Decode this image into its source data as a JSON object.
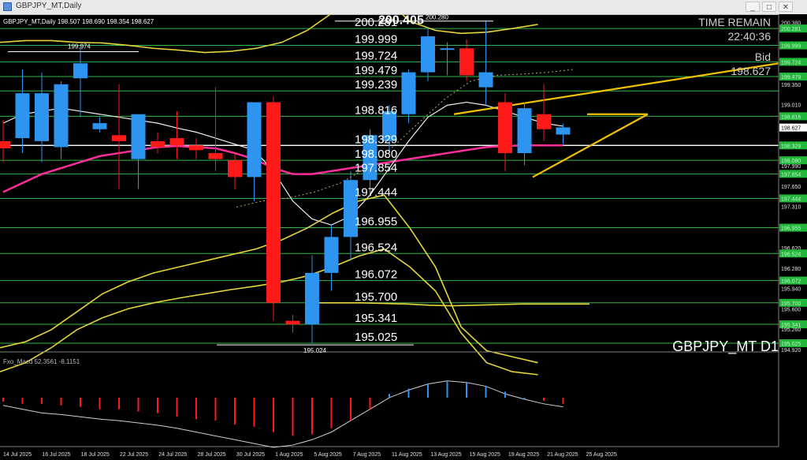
{
  "window": {
    "title": "GBPJPY_MT,Daily",
    "buttons": {
      "minimize": "_",
      "maximize": "□",
      "close": "✕"
    }
  },
  "chart_header": "GBPJPY_MT,Daily  198.507 198.690 198.354 198.627",
  "chart_data": {
    "type": "candlestick",
    "symbol_watermark": "GBPJPY_MT D1",
    "info_panel": {
      "label": "TIME REMAIN",
      "time": "22:40:36",
      "bid_label": "Bid",
      "bid_value": "198.627"
    },
    "ylim": [
      194.92,
      200.52
    ],
    "dates": [
      "14 Jul 2025",
      "16 Jul 2025",
      "18 Jul 2025",
      "22 Jul 2025",
      "24 Jul 2025",
      "28 Jul 2025",
      "30 Jul 2025",
      "1 Aug 2025",
      "5 Aug 2025",
      "7 Aug 2025",
      "11 Aug 2025",
      "13 Aug 2025",
      "15 Aug 2025",
      "19 Aug 2025",
      "21 Aug 2025",
      "25 Aug 2025"
    ],
    "candles": [
      {
        "o": 198.4,
        "h": 198.75,
        "l": 198.05,
        "c": 198.28
      },
      {
        "o": 198.45,
        "h": 199.6,
        "l": 198.2,
        "c": 199.2
      },
      {
        "o": 198.4,
        "h": 199.55,
        "l": 198.05,
        "c": 199.2
      },
      {
        "o": 198.3,
        "h": 199.4,
        "l": 198.1,
        "c": 199.35
      },
      {
        "o": 199.45,
        "h": 199.97,
        "l": 198.8,
        "c": 199.7
      },
      {
        "o": 198.6,
        "h": 198.8,
        "l": 198.55,
        "c": 198.7
      },
      {
        "o": 198.5,
        "h": 199.35,
        "l": 197.6,
        "c": 198.4
      },
      {
        "o": 198.1,
        "h": 198.7,
        "l": 197.6,
        "c": 198.85
      },
      {
        "o": 198.4,
        "h": 198.55,
        "l": 198.2,
        "c": 198.3
      },
      {
        "o": 198.45,
        "h": 198.9,
        "l": 198.1,
        "c": 198.33
      },
      {
        "o": 198.33,
        "h": 198.45,
        "l": 198.1,
        "c": 198.25
      },
      {
        "o": 198.2,
        "h": 199.3,
        "l": 197.9,
        "c": 198.1
      },
      {
        "o": 198.08,
        "h": 198.2,
        "l": 197.6,
        "c": 197.8
      },
      {
        "o": 197.8,
        "h": 198.1,
        "l": 197.4,
        "c": 199.05
      },
      {
        "o": 199.05,
        "h": 199.15,
        "l": 195.4,
        "c": 195.7
      },
      {
        "o": 195.4,
        "h": 195.5,
        "l": 195.2,
        "c": 195.34
      },
      {
        "o": 195.34,
        "h": 196.5,
        "l": 195.02,
        "c": 196.2
      },
      {
        "o": 196.2,
        "h": 197.0,
        "l": 195.9,
        "c": 196.8
      },
      {
        "o": 196.8,
        "h": 197.9,
        "l": 196.4,
        "c": 197.75
      },
      {
        "o": 197.75,
        "h": 198.6,
        "l": 197.5,
        "c": 198.5
      },
      {
        "o": 198.4,
        "h": 199.0,
        "l": 198.2,
        "c": 198.9
      },
      {
        "o": 198.85,
        "h": 199.6,
        "l": 198.7,
        "c": 199.55
      },
      {
        "o": 199.55,
        "h": 200.3,
        "l": 199.4,
        "c": 200.15
      },
      {
        "o": 199.95,
        "h": 200.05,
        "l": 199.5,
        "c": 199.95
      },
      {
        "o": 199.95,
        "h": 200.1,
        "l": 199.4,
        "c": 199.5
      },
      {
        "o": 199.3,
        "h": 200.4,
        "l": 199.0,
        "c": 199.55
      },
      {
        "o": 199.05,
        "h": 199.2,
        "l": 197.9,
        "c": 198.2
      },
      {
        "o": 198.2,
        "h": 199.05,
        "l": 198.0,
        "c": 198.95
      },
      {
        "o": 198.85,
        "h": 199.35,
        "l": 198.4,
        "c": 198.6
      },
      {
        "o": 198.51,
        "h": 198.69,
        "l": 198.35,
        "c": 198.63
      }
    ],
    "levels": [
      "200.281",
      "199.999",
      "199.724",
      "199.479",
      "199.239",
      "198.816",
      "198.329",
      "198.080",
      "197.854",
      "197.444",
      "196.955",
      "196.524",
      "196.072",
      "195.700",
      "195.341",
      "195.025"
    ],
    "marked_labels": {
      "high": "200.405",
      "high_small": "200.280",
      "swing_high": "199.974",
      "low": "195.024"
    },
    "yaxis_ticks": [
      "200.380",
      "200.281",
      "199.999",
      "199.724",
      "199.479",
      "199.350",
      "199.010",
      "198.816",
      "198.627",
      "198.329",
      "198.080",
      "197.990",
      "197.854",
      "197.650",
      "197.444",
      "197.310",
      "196.955",
      "196.620",
      "196.524",
      "196.280",
      "196.072",
      "195.940",
      "195.700",
      "195.600",
      "195.341",
      "195.260",
      "195.025",
      "194.920"
    ],
    "ma_fast": [
      198.7,
      198.85,
      198.9,
      198.95,
      198.9,
      198.85,
      198.8,
      198.75,
      198.7,
      198.62,
      198.55,
      198.45,
      198.35,
      198.25,
      197.9,
      197.4,
      197.1,
      197.0,
      197.15,
      197.5,
      197.95,
      198.4,
      198.8,
      199.0,
      199.05,
      199.0,
      198.9,
      198.8,
      198.7,
      198.65
    ],
    "ma_slow": [
      197.55,
      197.7,
      197.85,
      197.95,
      198.05,
      198.15,
      198.2,
      198.25,
      198.3,
      198.32,
      198.3,
      198.28,
      198.2,
      198.1,
      197.95,
      197.85,
      197.85,
      197.9,
      197.95,
      198.0,
      198.05,
      198.1,
      198.15,
      198.2,
      198.25,
      198.3,
      198.32,
      198.33,
      198.33,
      198.33
    ],
    "band_upper": [
      200.05,
      200.08,
      200.08,
      200.05,
      200.04,
      200.0,
      199.95,
      199.92,
      199.88,
      199.9,
      199.95,
      200.05,
      200.25,
      200.55,
      200.7,
      200.8,
      200.4,
      200.25,
      200.2,
      200.22,
      200.28,
      200.35
    ],
    "band_lower": [
      194.95,
      195.05,
      195.25,
      195.55,
      195.85,
      196.05,
      196.2,
      196.3,
      196.4,
      196.5,
      196.6,
      196.75,
      196.95,
      197.2,
      197.4,
      197.5,
      196.95,
      196.3,
      195.3,
      194.9,
      194.8,
      194.7
    ],
    "band_lower2": [
      194.55,
      194.7,
      194.95,
      195.25,
      195.45,
      195.6,
      195.7,
      195.78,
      195.85,
      195.92,
      195.98,
      196.05,
      196.15,
      196.3,
      196.48,
      196.6,
      196.3,
      195.9,
      195.2,
      194.7,
      194.55,
      194.5
    ],
    "band_yellow_low": [
      195.7,
      195.7,
      195.7,
      195.69,
      195.68,
      195.66,
      195.65,
      195.66,
      195.67,
      195.68,
      195.68,
      195.68,
      195.68
    ],
    "indicator": {
      "label": "Fxo_Macd 52.3561 -8.1151",
      "ylim": [
        "59.9035",
        "-63.5331"
      ],
      "line": [
        -10,
        -15,
        -20,
        -22,
        -25,
        -28,
        -30,
        -33,
        -36,
        -40,
        -45,
        -50,
        -55,
        -60,
        -65,
        -62,
        -55,
        -45,
        -30,
        -15,
        0,
        10,
        18,
        22,
        20,
        15,
        5,
        -2,
        -8,
        -12
      ],
      "histogram": [
        -5,
        -8,
        -8,
        -10,
        -12,
        -15,
        -15,
        -18,
        -20,
        -25,
        -28,
        -30,
        -35,
        -38,
        -45,
        -50,
        -48,
        -40,
        -30,
        -15,
        5,
        12,
        18,
        22,
        20,
        15,
        8,
        0,
        -4,
        -8
      ]
    }
  }
}
